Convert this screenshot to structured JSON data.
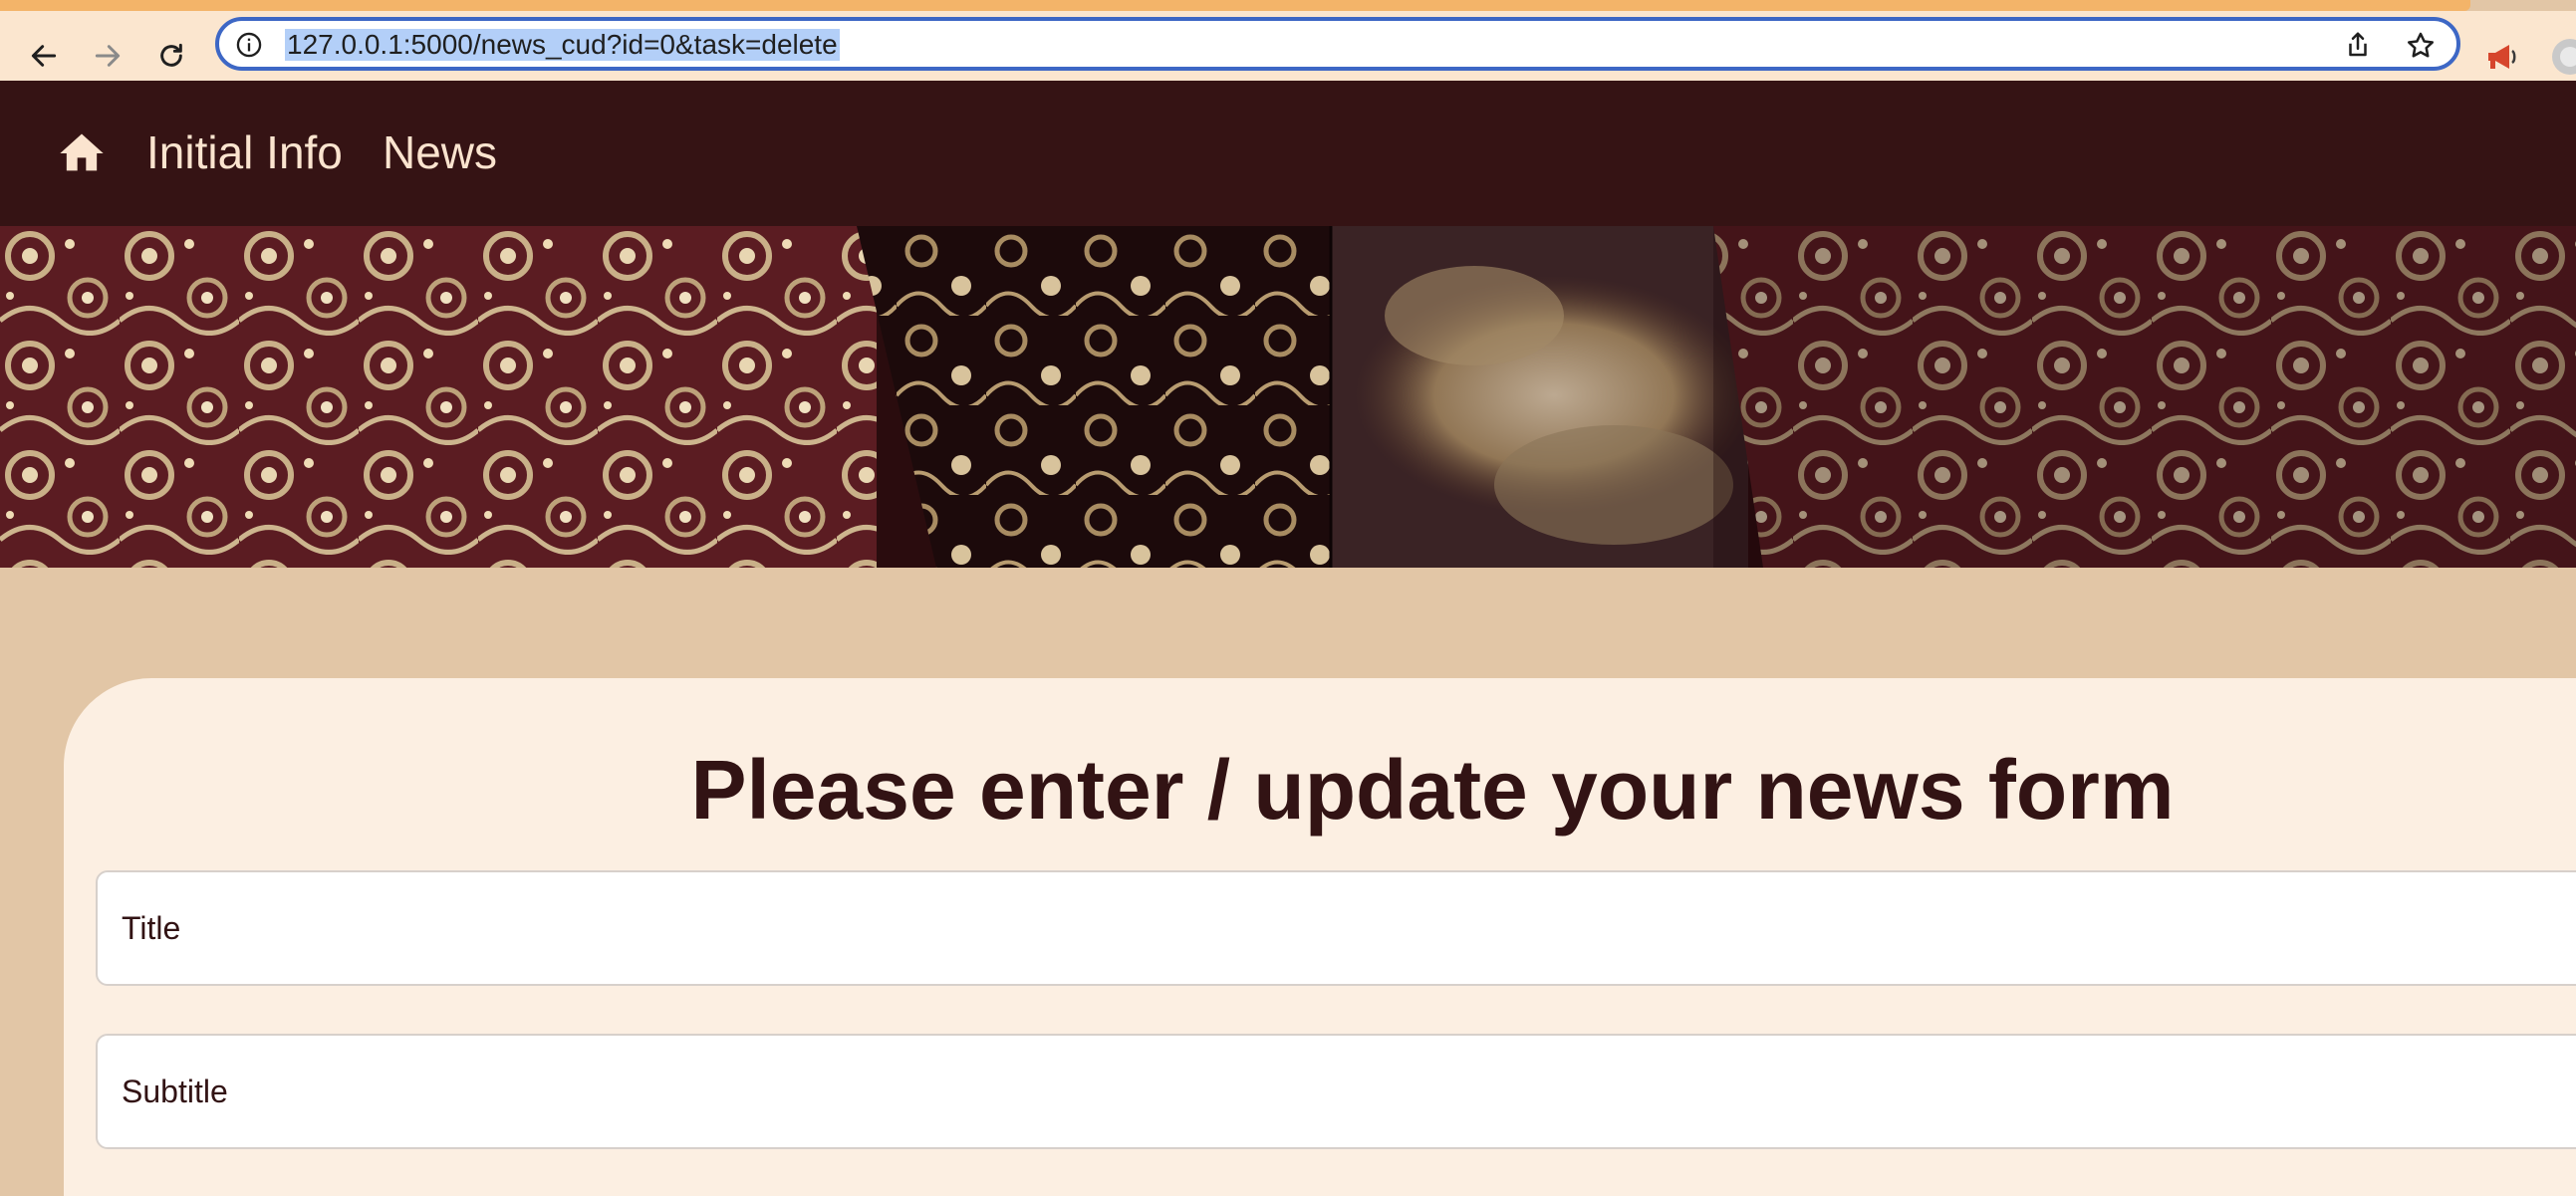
{
  "browser": {
    "url": "127.0.0.1:5000/news_cud?id=0&task=delete",
    "icons": [
      "back-arrow-icon",
      "forward-arrow-icon",
      "reload-icon",
      "info-icon",
      "share-icon",
      "star-icon",
      "megaphone-extension-icon"
    ]
  },
  "nav": {
    "home_icon": "home-icon",
    "links": [
      "Initial Info",
      "News"
    ]
  },
  "form": {
    "heading": "Please enter / update your news form",
    "title_placeholder": "Title",
    "subtitle_placeholder": "Subtitle"
  },
  "colors": {
    "nav_bg": "#351314",
    "page_bg": "#e2c6a6",
    "card_bg": "#fcefe2",
    "text_dark": "#321314",
    "nav_text": "#fbe4cf"
  }
}
